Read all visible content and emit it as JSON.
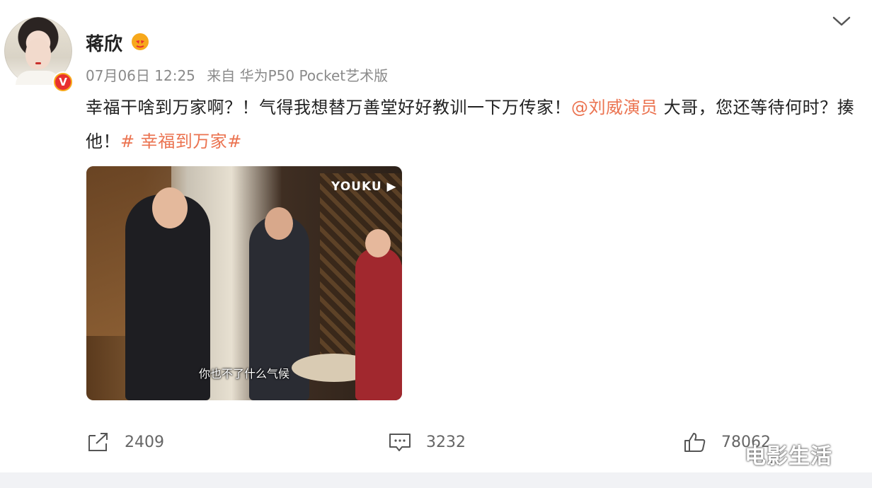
{
  "post": {
    "username": "蒋欣",
    "date": "07月06日 12:25",
    "source": "来自 华为P50 Pocket艺术版",
    "text_before": "幸福干啥到万家啊？！气得我想替万善堂好好教训一下万传家！",
    "mention": "@刘威演员",
    "text_after": " 大哥，您还等待何时？揍他！",
    "topic": "# 幸福到万家#",
    "verified_badge": "V"
  },
  "video": {
    "platform_logo": "YOUKU ▶",
    "subtitle": "你也不了什么气候"
  },
  "actions": {
    "repost_count": "2409",
    "comment_count": "3232",
    "like_count": "78062"
  },
  "watermark": "电影生活",
  "colors": {
    "accent": "#eb7350",
    "badge_gold": "#f7a81b",
    "badge_red": "#e8302e"
  }
}
